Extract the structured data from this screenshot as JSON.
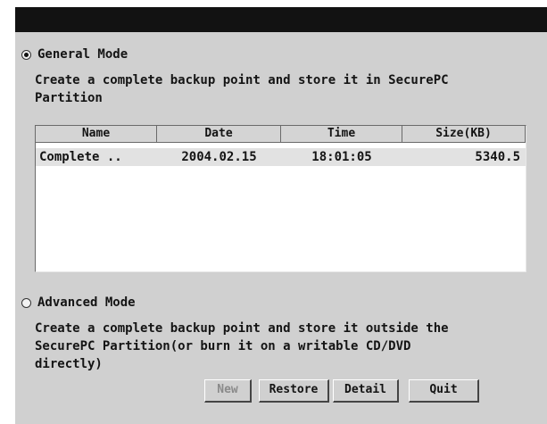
{
  "general": {
    "label": "General Mode",
    "selected": true,
    "description": "Create a complete backup point and store it in SecurePC\nPartition"
  },
  "table": {
    "columns": [
      "Name",
      "Date",
      "Time",
      "Size(KB)"
    ],
    "rows": [
      {
        "name": "Complete ..",
        "date": "2004.02.15",
        "time": "18:01:05",
        "size": "5340.5"
      }
    ]
  },
  "advanced": {
    "label": "Advanced Mode",
    "selected": false,
    "description": "Create a complete backup point and store it outside the\nSecurePC Partition(or burn it on a writable CD/DVD\ndirectly)"
  },
  "buttons": {
    "new": "New",
    "restore": "Restore",
    "detail": "Detail",
    "quit": "Quit"
  }
}
